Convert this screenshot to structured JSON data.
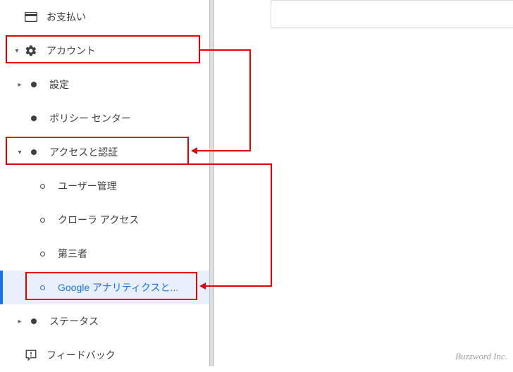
{
  "sidebar": {
    "payments": "お支払い",
    "account": "アカウント",
    "settings": "設定",
    "policy_center": "ポリシー センター",
    "access_auth": "アクセスと認証",
    "user_mgmt": "ユーザー管理",
    "crawler_access": "クローラ アクセス",
    "third_party": "第三者",
    "google_analytics": "Google アナリティクスと...",
    "status": "ステータス",
    "feedback": "フィードバック"
  },
  "footer": {
    "brand": "Buzzword Inc."
  }
}
